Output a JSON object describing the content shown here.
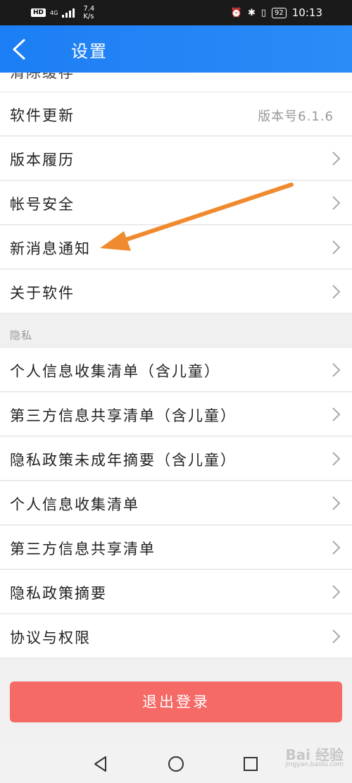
{
  "status_bar": {
    "hd": "HD",
    "network": "4G",
    "speed_value": "7.4",
    "speed_unit": "K/s",
    "battery": "92",
    "time": "10:13"
  },
  "header": {
    "title": "设置"
  },
  "rows": {
    "clear_cache": "清除缓存",
    "software_update": "软件更新",
    "version_label": "版本号6.1.6",
    "version_history": "版本履历",
    "account_security": "帐号安全",
    "new_message_notification": "新消息通知",
    "about_software": "关于软件"
  },
  "privacy": {
    "section_title": "隐私",
    "items": [
      "个人信息收集清单（含儿童）",
      "第三方信息共享清单（含儿童）",
      "隐私政策未成年摘要（含儿童）",
      "个人信息收集清单",
      "第三方信息共享清单",
      "隐私政策摘要",
      "协议与权限"
    ]
  },
  "logout_label": "退出登录",
  "watermark": {
    "main": "Bai 经验",
    "sub": "jingyan.baidu.com"
  },
  "colors": {
    "header_blue": "#1c7ef4",
    "logout_red": "#f56966",
    "annotation_orange": "#f08a2e"
  },
  "icons": [
    "back-icon",
    "chevron-right-icon",
    "nav-back-icon",
    "nav-home-icon",
    "nav-recents-icon"
  ]
}
